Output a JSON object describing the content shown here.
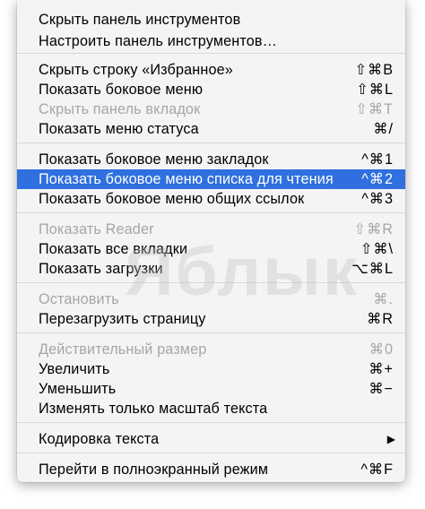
{
  "watermark": "Яблык",
  "menu": {
    "groups": [
      [
        {
          "label": "Скрыть панель инструментов",
          "shortcut": "",
          "enabled": true
        },
        {
          "label": "Настроить панель инструментов…",
          "shortcut": "",
          "enabled": true
        }
      ],
      [
        {
          "label": "Скрыть строку «Избранное»",
          "shortcut": "⇧⌘B",
          "enabled": true
        },
        {
          "label": "Показать боковое меню",
          "shortcut": "⇧⌘L",
          "enabled": true
        },
        {
          "label": "Скрыть панель вкладок",
          "shortcut": "⇧⌘T",
          "enabled": false
        },
        {
          "label": "Показать меню статуса",
          "shortcut": "⌘/",
          "enabled": true
        }
      ],
      [
        {
          "label": "Показать боковое меню закладок",
          "shortcut": "^⌘1",
          "enabled": true
        },
        {
          "label": "Показать боковое меню списка для чтения",
          "shortcut": "^⌘2",
          "enabled": true,
          "selected": true
        },
        {
          "label": "Показать боковое меню общих ссылок",
          "shortcut": "^⌘3",
          "enabled": true
        }
      ],
      [
        {
          "label": "Показать Reader",
          "shortcut": "⇧⌘R",
          "enabled": false
        },
        {
          "label": "Показать все вкладки",
          "shortcut": "⇧⌘\\",
          "enabled": true
        },
        {
          "label": "Показать загрузки",
          "shortcut": "⌥⌘L",
          "enabled": true
        }
      ],
      [
        {
          "label": "Остановить",
          "shortcut": "⌘.",
          "enabled": false
        },
        {
          "label": "Перезагрузить страницу",
          "shortcut": "⌘R",
          "enabled": true
        }
      ],
      [
        {
          "label": "Действительный размер",
          "shortcut": "⌘0",
          "enabled": false
        },
        {
          "label": "Увеличить",
          "shortcut": "⌘+",
          "enabled": true
        },
        {
          "label": "Уменьшить",
          "shortcut": "⌘−",
          "enabled": true
        },
        {
          "label": "Изменять только масштаб текста",
          "shortcut": "",
          "enabled": true
        }
      ],
      [
        {
          "label": "Кодировка текста",
          "shortcut": "",
          "enabled": true,
          "submenu": true,
          "submenu_icon": "right-triangle-icon"
        }
      ],
      [
        {
          "label": "Перейти в полноэкранный режим",
          "shortcut": "^⌘F",
          "enabled": true
        }
      ]
    ]
  }
}
